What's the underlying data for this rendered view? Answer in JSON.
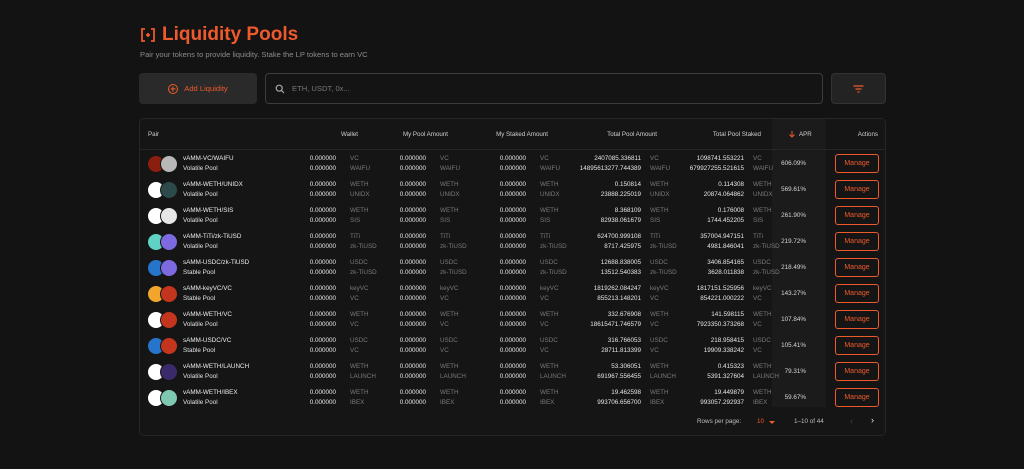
{
  "header": {
    "title": "Liquidity Pools",
    "subtitle": "Pair your tokens to provide liquidity. Stake the LP tokens to earn VC"
  },
  "toolbar": {
    "add_label": "Add Liquidity",
    "search_placeholder": "ETH, USDT, 0x..."
  },
  "table": {
    "headers": {
      "pair": "Pair",
      "wallet": "Wallet",
      "my_pool": "My Pool Amount",
      "my_staked": "My Staked Amount",
      "total_pool": "Total Pool Amount",
      "total_staked": "Total Pool Staked",
      "apr": "APR",
      "actions": "Actions"
    },
    "manage_label": "Manage",
    "rows": [
      {
        "pair": "vAMM-VC/WAIFU",
        "type": "Volatile Pool",
        "ia": "#8a1f10",
        "ib": "#b8b8b8",
        "u1": "VC",
        "u2": "WAIFU",
        "wallet": [
          "0.000000",
          "0.000000"
        ],
        "mypool": [
          "0.000000",
          "0.000000"
        ],
        "mystaked": [
          "0.000000",
          "0.000000"
        ],
        "totalpool": [
          "2407085.336811",
          "14895613277.744389"
        ],
        "totalstaked": [
          "1098741.553221",
          "679927255.521615"
        ],
        "apr": "606.09%"
      },
      {
        "pair": "vAMM-WETH/UNIDX",
        "type": "Volatile Pool",
        "ia": "#ffffff",
        "ib": "#2c4a49",
        "u1": "WETH",
        "u2": "UNIDX",
        "wallet": [
          "0.000000",
          "0.000000"
        ],
        "mypool": [
          "0.000000",
          "0.000000"
        ],
        "mystaked": [
          "0.000000",
          "0.000000"
        ],
        "totalpool": [
          "0.150814",
          "23888.225019"
        ],
        "totalstaked": [
          "0.114308",
          "20874.064862"
        ],
        "apr": "569.61%"
      },
      {
        "pair": "vAMM-WETH/SIS",
        "type": "Volatile Pool",
        "ia": "#ffffff",
        "ib": "#e6e6e6",
        "u1": "WETH",
        "u2": "SIS",
        "wallet": [
          "0.000000",
          "0.000000"
        ],
        "mypool": [
          "0.000000",
          "0.000000"
        ],
        "mystaked": [
          "0.000000",
          "0.000000"
        ],
        "totalpool": [
          "8.368109",
          "82938.061679"
        ],
        "totalstaked": [
          "0.176008",
          "1744.452205"
        ],
        "apr": "261.90%"
      },
      {
        "pair": "vAMM-TiTi/zk-TiUSD",
        "type": "Volatile Pool",
        "ia": "#5fd2c4",
        "ib": "#7d6ae0",
        "u1": "TiTi",
        "u2": "zk-TiUSD",
        "wallet": [
          "0.000000",
          "0.000000"
        ],
        "mypool": [
          "0.000000",
          "0.000000"
        ],
        "mystaked": [
          "0.000000",
          "0.000000"
        ],
        "totalpool": [
          "624700.999108",
          "8717.425975"
        ],
        "totalstaked": [
          "357004.947151",
          "4981.846041"
        ],
        "apr": "219.72%"
      },
      {
        "pair": "sAMM-USDC/zk-TiUSD",
        "type": "Stable Pool",
        "ia": "#2775ca",
        "ib": "#7d6ae0",
        "u1": "USDC",
        "u2": "zk-TiUSD",
        "wallet": [
          "0.000000",
          "0.000000"
        ],
        "mypool": [
          "0.000000",
          "0.000000"
        ],
        "mystaked": [
          "0.000000",
          "0.000000"
        ],
        "totalpool": [
          "12688.838005",
          "13512.540383"
        ],
        "totalstaked": [
          "3406.854165",
          "3628.011838"
        ],
        "apr": "218.49%"
      },
      {
        "pair": "sAMM-keyVC/VC",
        "type": "Stable Pool",
        "ia": "#f1a52b",
        "ib": "#c4351d",
        "u1": "keyVC",
        "u2": "VC",
        "wallet": [
          "0.000000",
          "0.000000"
        ],
        "mypool": [
          "0.000000",
          "0.000000"
        ],
        "mystaked": [
          "0.000000",
          "0.000000"
        ],
        "totalpool": [
          "1819262.084247",
          "855213.148201"
        ],
        "totalstaked": [
          "1817151.525956",
          "854221.000222"
        ],
        "apr": "143.27%"
      },
      {
        "pair": "vAMM-WETH/VC",
        "type": "Volatile Pool",
        "ia": "#ffffff",
        "ib": "#c4351d",
        "u1": "WETH",
        "u2": "VC",
        "wallet": [
          "0.000000",
          "0.000000"
        ],
        "mypool": [
          "0.000000",
          "0.000000"
        ],
        "mystaked": [
          "0.000000",
          "0.000000"
        ],
        "totalpool": [
          "332.676908",
          "18615471.746579"
        ],
        "totalstaked": [
          "141.598115",
          "7923350.373268"
        ],
        "apr": "107.84%"
      },
      {
        "pair": "sAMM-USDC/VC",
        "type": "Stable Pool",
        "ia": "#2775ca",
        "ib": "#c4351d",
        "u1": "USDC",
        "u2": "VC",
        "wallet": [
          "0.000000",
          "0.000000"
        ],
        "mypool": [
          "0.000000",
          "0.000000"
        ],
        "mystaked": [
          "0.000000",
          "0.000000"
        ],
        "totalpool": [
          "316.766053",
          "28711.813399"
        ],
        "totalstaked": [
          "218.958415",
          "19909.338242"
        ],
        "apr": "105.41%"
      },
      {
        "pair": "vAMM-WETH/LAUNCH",
        "type": "Volatile Pool",
        "ia": "#ffffff",
        "ib": "#3b2a6b",
        "u1": "WETH",
        "u2": "LAUNCH",
        "wallet": [
          "0.000000",
          "0.000000"
        ],
        "mypool": [
          "0.000000",
          "0.000000"
        ],
        "mystaked": [
          "0.000000",
          "0.000000"
        ],
        "totalpool": [
          "53.306051",
          "691967.556455"
        ],
        "totalstaked": [
          "0.415323",
          "5391.327604"
        ],
        "apr": "79.31%"
      },
      {
        "pair": "vAMM-WETH/IBEX",
        "type": "Volatile Pool",
        "ia": "#ffffff",
        "ib": "#7ec7b0",
        "u1": "WETH",
        "u2": "IBEX",
        "wallet": [
          "0.000000",
          "0.000000"
        ],
        "mypool": [
          "0.000000",
          "0.000000"
        ],
        "mystaked": [
          "0.000000",
          "0.000000"
        ],
        "totalpool": [
          "19.462598",
          "993706.656700"
        ],
        "totalstaked": [
          "19.449879",
          "993057.292937"
        ],
        "apr": "59.67%"
      }
    ],
    "footer": {
      "rows_per_page_label": "Rows per page:",
      "rows_per_page_value": "10",
      "range": "1–10 of 44"
    }
  },
  "colors": {
    "accent": "#ee5a2c",
    "background": "#131313"
  },
  "icons": [
    "pool-logo-icon",
    "search-icon",
    "filter-icon",
    "add-circle-icon",
    "sort-arrow-down-icon",
    "chevron-left-icon",
    "chevron-right-icon"
  ]
}
